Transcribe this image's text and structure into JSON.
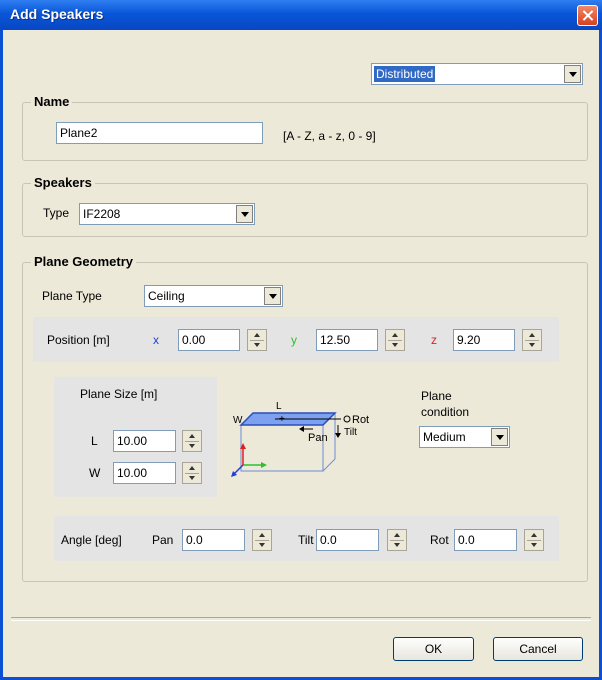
{
  "window": {
    "title": "Add Speakers"
  },
  "mode_select": {
    "value": "Distributed"
  },
  "name_group": {
    "label": "Name",
    "value": "Plane2",
    "hint": "[A - Z, a - z, 0 - 9]"
  },
  "speakers_group": {
    "label": "Speakers",
    "type_label": "Type",
    "type_value": "IF2208"
  },
  "geometry": {
    "label": "Plane Geometry",
    "plane_type_label": "Plane Type",
    "plane_type_value": "Ceiling",
    "position": {
      "label": "Position [m]",
      "x_label": "x",
      "x_value": "0.00",
      "y_label": "y",
      "y_value": "12.50",
      "z_label": "z",
      "z_value": "9.20"
    },
    "size": {
      "label": "Plane Size [m]",
      "l_label": "L",
      "l_value": "10.00",
      "w_label": "W",
      "w_value": "10.00"
    },
    "diagram": {
      "l": "L",
      "w": "W",
      "rot": "Rot",
      "pan": "Pan",
      "tilt": "Tilt"
    },
    "condition": {
      "label_line1": "Plane",
      "label_line2": "condition",
      "value": "Medium"
    },
    "angle": {
      "label": "Angle [deg]",
      "pan_label": "Pan",
      "pan_value": "0.0",
      "tilt_label": "Tilt",
      "tilt_value": "0.0",
      "rot_label": "Rot",
      "rot_value": "0.0"
    }
  },
  "buttons": {
    "ok": "OK",
    "cancel": "Cancel"
  },
  "colors": {
    "x_axis": "#1f3fd6",
    "y_axis": "#2fbf2f",
    "z_axis": "#e02020",
    "title_bar": "#0a56d8"
  }
}
